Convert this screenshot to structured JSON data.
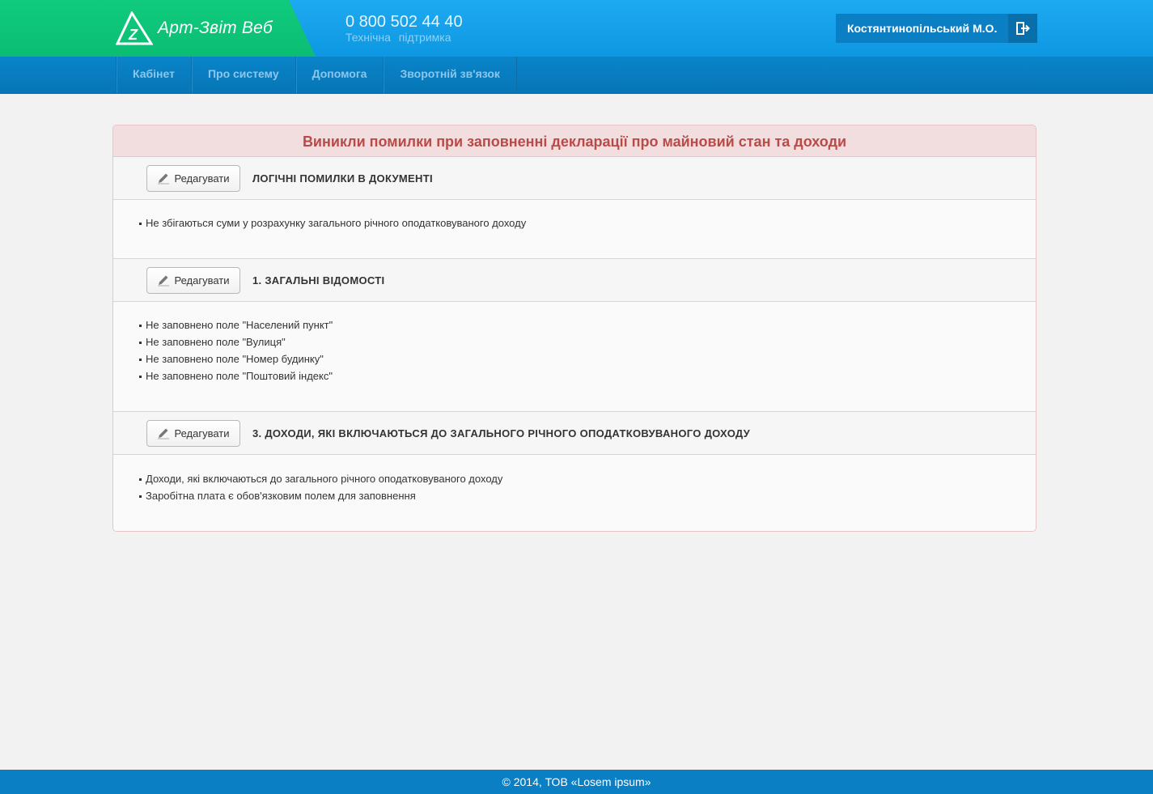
{
  "header": {
    "logo_text": "Арт-Звіт Веб",
    "phone": "0 800 502 44 40",
    "support": "Технічна підтримка",
    "user_name": "Костянтинопільський М.О."
  },
  "nav": {
    "items": [
      {
        "label": "Кабінет"
      },
      {
        "label": "Про систему"
      },
      {
        "label": "Допомога"
      },
      {
        "label": "Зворотній зв'язок"
      }
    ]
  },
  "panel": {
    "title": "Виникли помилки при заповненні декларації про майновий стан та доходи",
    "edit_label": "Редагувати",
    "sections": [
      {
        "title": "ЛОГІЧНІ ПОМИЛКИ В ДОКУМЕНТІ",
        "errors": [
          "Не збігаються суми у розрахунку загального річного оподатковуваного доходу"
        ]
      },
      {
        "title": "1. ЗАГАЛЬНІ ВІДОМОСТІ",
        "errors": [
          "Не заповнено поле \"Населений пункт\"",
          "Не заповнено поле \"Вулиця\"",
          "Не заповнено поле \"Номер будинку\"",
          "Не заповнено поле \"Поштовий індекс\""
        ]
      },
      {
        "title": "3. ДОХОДИ, ЯКІ ВКЛЮЧАЮТЬСЯ ДО ЗАГАЛЬНОГО РІЧНОГО ОПОДАТКОВУВАНОГО ДОХОДУ",
        "errors": [
          "Доходи, які включаються до загального річного оподатковуваного доходу",
          "Заробітна плата є обов'язковим полем для заповнення"
        ]
      }
    ]
  },
  "footer": {
    "text": "© 2014, ТОВ «Losem ipsum»"
  }
}
